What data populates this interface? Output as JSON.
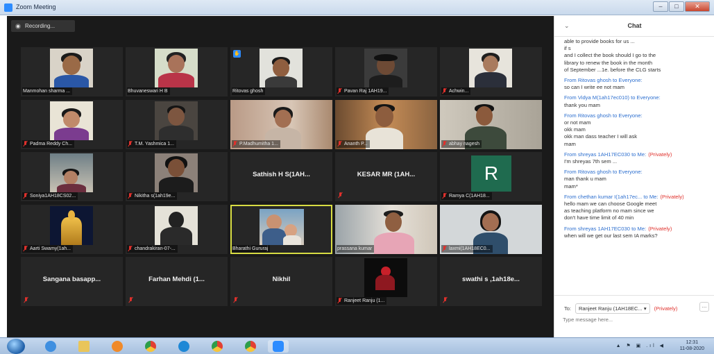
{
  "window": {
    "title": "Zoom Meeting"
  },
  "window_controls": {
    "minimize": "–",
    "maximize": "□",
    "close": "✕"
  },
  "recording": {
    "label": "Recording..."
  },
  "tiles": [
    {
      "name": "Manmohan sharma ...",
      "muted": false,
      "video": true
    },
    {
      "name": "Bhuvaneswari H B",
      "muted": false,
      "video": true
    },
    {
      "name": "Ritovas ghosh",
      "muted": false,
      "video": true,
      "hand_raised": true
    },
    {
      "name": "Pavan Raj 1AH19...",
      "muted": true,
      "video": true
    },
    {
      "name": "Achwin...",
      "muted": true,
      "video": true
    },
    {
      "name": "Padma Reddy Ch...",
      "muted": true,
      "video": true
    },
    {
      "name": "T.M. Yashmica 1...",
      "muted": true,
      "video": true
    },
    {
      "name": "P.Madhumitha 1...",
      "muted": true,
      "video": true
    },
    {
      "name": "Ananth P...",
      "muted": true,
      "video": true
    },
    {
      "name": "abhay nagesh",
      "muted": true,
      "video": true
    },
    {
      "name": "Soniya1AH18CS02...",
      "muted": true,
      "video": true
    },
    {
      "name": "Nikitha s(1ah19e...",
      "muted": true,
      "video": true
    },
    {
      "name": "Sathish H S(1AH...",
      "muted": false,
      "video": false
    },
    {
      "name": "KESAR MR (1AH...",
      "muted": true,
      "video": false
    },
    {
      "name": "Ramya C(1AH18...",
      "muted": true,
      "video": false,
      "avatar_letter": "R"
    },
    {
      "name": "Aarti Swamy(1ah...",
      "muted": true,
      "video": true
    },
    {
      "name": "chandrakiran-07-...",
      "muted": true,
      "video": true
    },
    {
      "name": "Bharathi Gururaj",
      "muted": false,
      "video": true,
      "active_speaker": true
    },
    {
      "name": "prassana kumar",
      "muted": false,
      "video": true
    },
    {
      "name": "laxmi(1AH18EC0...",
      "muted": true,
      "video": true
    },
    {
      "name": "Sangana basapp...",
      "muted": true,
      "video": false
    },
    {
      "name": "Farhan Mehdi (1...",
      "muted": true,
      "video": false
    },
    {
      "name": "Nikhil",
      "muted": true,
      "video": false
    },
    {
      "name": "Ranjeet Ranju (1...",
      "muted": true,
      "video": true
    },
    {
      "name": "swathi s ,1ah18e...",
      "muted": true,
      "video": false
    }
  ],
  "chat": {
    "title": "Chat",
    "intro_lines": [
      "able to provide books for us ...",
      "if s",
      "and I collect the book should I go to the",
      "library to renew the book in the month",
      "of September ...1e. before the CLG starts"
    ],
    "messages": [
      {
        "from": "From Ritovas ghosh to Everyone:",
        "private": "",
        "lines": [
          "so can I write ee not mam"
        ]
      },
      {
        "from": "From Vidya M(1ah17ec010) to Everyone:",
        "private": "",
        "lines": [
          "thank you mam"
        ]
      },
      {
        "from": "From Ritovas ghosh to Everyone:",
        "private": "",
        "lines": [
          "or not mam",
          "okk mam",
          "okk man dass teacher I will ask",
          "mam"
        ]
      },
      {
        "from": "From shreyas 1AH17EC030 to Me:",
        "private": "(Privately)",
        "lines": [
          "I'm shreyas 7th sem ..."
        ]
      },
      {
        "from": "From Ritovas ghosh to Everyone:",
        "private": "",
        "lines": [
          "man thank u mam",
          "mam*"
        ]
      },
      {
        "from": "From chethan kumar I(1ah17ec... to Me:",
        "private": "(Privately)",
        "lines": [
          "hello mam we can choose Google meet",
          "as teaching platform no mam since we",
          "don't have time limit of 40 min"
        ]
      },
      {
        "from": "From shreyas 1AH17EC030 to Me:",
        "private": "(Privately)",
        "lines": [
          "when will we get our last sem IA marks?"
        ]
      }
    ],
    "to_label": "To:",
    "to_value": "Ranjeet Ranju (1AH18EC... ▾",
    "to_private": "(Privately)",
    "more": "...",
    "input_placeholder": "Type message here..."
  },
  "taskbar": {
    "tray": "▲ ⚑ ▣ .ıl ◀",
    "time": "12:31",
    "date": "11-08-2020"
  },
  "colors": {
    "active_speaker": "#d8dd43",
    "muted_mic": "#e0312c",
    "link_blue": "#2d6fcf",
    "zoom_blue": "#2d8cff"
  }
}
